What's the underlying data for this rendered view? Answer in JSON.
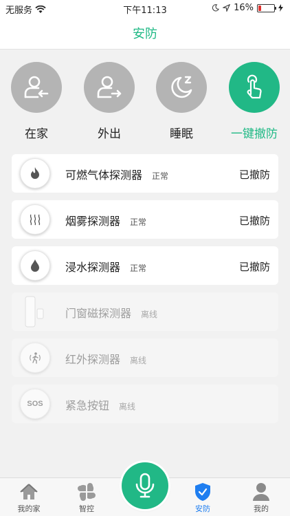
{
  "status_bar": {
    "carrier": "无服务",
    "time": "下午11:13",
    "battery": "16%",
    "battery_level": 0.16,
    "battery_color": "#e0322f"
  },
  "nav": {
    "title": "安防"
  },
  "modes": [
    {
      "label": "在家",
      "icon": "home-arrive-icon",
      "active": false
    },
    {
      "label": "外出",
      "icon": "leave-home-icon",
      "active": false
    },
    {
      "label": "睡眠",
      "icon": "moon-icon",
      "active": false
    },
    {
      "label": "一键撤防",
      "icon": "tap-hand-icon",
      "active": true
    }
  ],
  "devices": [
    {
      "name": "可燃气体探测器",
      "status": "正常",
      "arm_state": "已撤防",
      "icon": "flame-icon",
      "online": true
    },
    {
      "name": "烟雾探测器",
      "status": "正常",
      "arm_state": "已撤防",
      "icon": "smoke-icon",
      "online": true
    },
    {
      "name": "浸水探测器",
      "status": "正常",
      "arm_state": "已撤防",
      "icon": "water-drop-icon",
      "online": true
    },
    {
      "name": "门窗磁探测器",
      "status": "离线",
      "arm_state": "",
      "icon": "door-sensor-icon",
      "online": false
    },
    {
      "name": "红外探测器",
      "status": "离线",
      "arm_state": "",
      "icon": "motion-icon",
      "online": false
    },
    {
      "name": "紧急按钮",
      "status": "离线",
      "arm_state": "",
      "icon": "sos-icon",
      "icon_text": "SOS",
      "online": false
    }
  ],
  "tabs": [
    {
      "label": "我的家",
      "icon": "house-icon",
      "active": false
    },
    {
      "label": "智控",
      "icon": "grid-petals-icon",
      "active": false
    },
    {
      "label": "安防",
      "icon": "shield-check-icon",
      "active": true
    },
    {
      "label": "我的",
      "icon": "person-icon",
      "active": false
    }
  ],
  "colors": {
    "accent": "#1fb985",
    "inactive_circle": "#b4b4b4",
    "tab_active": "#1f7ef0"
  }
}
